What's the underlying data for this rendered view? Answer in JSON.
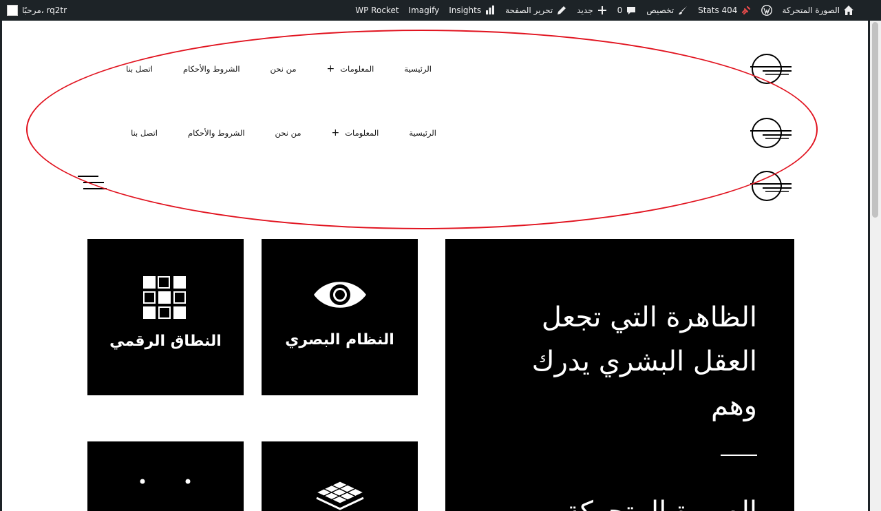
{
  "admin_bar": {
    "greeting": "مرحبًا، rq2tr",
    "items": [
      {
        "label": "الصورة المتحركة",
        "icon": "home-icon"
      },
      {
        "label": "",
        "icon": "wordpress-icon"
      },
      {
        "label": "Stats 404",
        "icon": "broken-link-icon"
      },
      {
        "label": "تخصيص",
        "icon": "brush-icon"
      },
      {
        "label": "0",
        "icon": "comment-icon"
      },
      {
        "label": "جديد",
        "icon": "plus-icon"
      },
      {
        "label": "تحرير الصفحة",
        "icon": "pencil-icon"
      },
      {
        "label": "Insights",
        "icon": "bar-chart-icon"
      },
      {
        "label": "Imagify",
        "icon": ""
      },
      {
        "label": "WP Rocket",
        "icon": ""
      }
    ]
  },
  "nav": {
    "home": "الرئيسية",
    "info": "المعلومات",
    "about": "من نحن",
    "terms": "الشروط والأحكام",
    "contact": "اتصل بنا",
    "submenu_indicator": "+"
  },
  "cards": [
    {
      "title": "النظام البصري",
      "icon": "eye-icon"
    },
    {
      "title": "النطاق الرقمي",
      "icon": "grid-icon"
    },
    {
      "title": "",
      "icon": "layers-icon"
    },
    {
      "title": "",
      "icon": "dots-icon"
    }
  ],
  "hero": {
    "lines": [
      "الظاهرة التي تجعل",
      "العقل البشري يدرك",
      "وهم"
    ],
    "next_line": "الصورة المتحركة"
  },
  "colors": {
    "admin_bar_bg": "#1d2327",
    "annotation": "#e1131f",
    "card_bg": "#000000"
  }
}
